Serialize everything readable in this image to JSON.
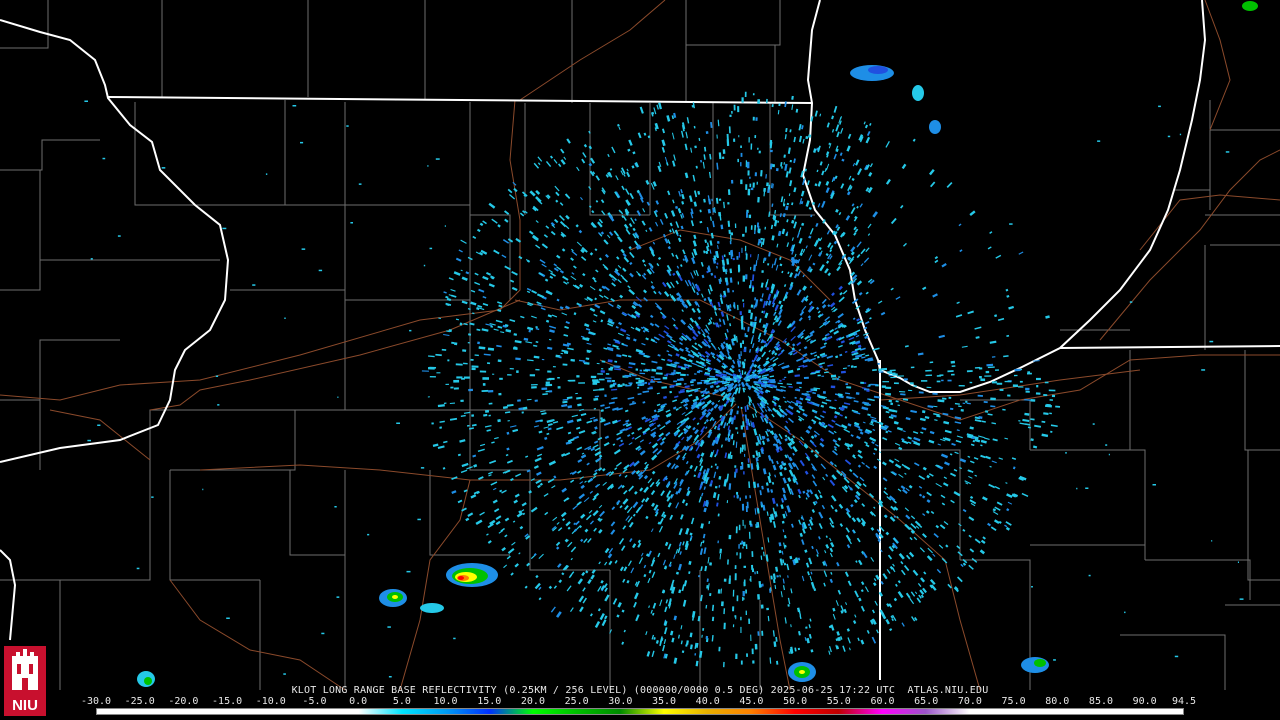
{
  "caption": {
    "radar_site": "KLOT",
    "product": "LONG RANGE BASE REFLECTIVITY",
    "resolution": "(0.25KM / 256 LEVEL)",
    "volume": "(000000/0000",
    "tilt": "0.5 DEG)",
    "datetime": "2025-06-25 17:22 UTC",
    "source": "ATLAS.NIU.EDU"
  },
  "colorbar": {
    "ticks": [
      "-30.0",
      "-25.0",
      "-20.0",
      "-15.0",
      "-10.0",
      "-5.0",
      "0.0",
      "5.0",
      "10.0",
      "15.0",
      "20.0",
      "25.0",
      "30.0",
      "35.0",
      "40.0",
      "45.0",
      "50.0",
      "55.0",
      "60.0",
      "65.0",
      "70.0",
      "75.0",
      "80.0",
      "85.0",
      "90.0",
      "94.5"
    ],
    "stops": [
      {
        "dbz": -30,
        "color": "#ffffff"
      },
      {
        "dbz": 0,
        "color": "#ffffff"
      },
      {
        "dbz": 5,
        "color": "#00e4ff"
      },
      {
        "dbz": 10,
        "color": "#009cf4"
      },
      {
        "dbz": 15,
        "color": "#0030ff"
      },
      {
        "dbz": 20,
        "color": "#00ff00"
      },
      {
        "dbz": 25,
        "color": "#00c000"
      },
      {
        "dbz": 30,
        "color": "#008c00"
      },
      {
        "dbz": 35,
        "color": "#ffff00"
      },
      {
        "dbz": 40,
        "color": "#e8b000"
      },
      {
        "dbz": 45,
        "color": "#ff8000"
      },
      {
        "dbz": 50,
        "color": "#ff0000"
      },
      {
        "dbz": 55,
        "color": "#c00000"
      },
      {
        "dbz": 60,
        "color": "#ff00ff"
      },
      {
        "dbz": 65,
        "color": "#9b55c9"
      },
      {
        "dbz": 70,
        "color": "#ffffff"
      },
      {
        "dbz": 94.5,
        "color": "#ffffff"
      }
    ]
  },
  "colors": {
    "background": "#000000",
    "state_borders": "#ffffff",
    "county_lines": "#7a7a7a",
    "highways": "#8b4a2b",
    "echo_light": "#25c9e8",
    "echo_medium": "#1e8ee6",
    "echo_strong": "#2050e0"
  },
  "logo": {
    "text": "NIU",
    "color": "#c8102e"
  }
}
